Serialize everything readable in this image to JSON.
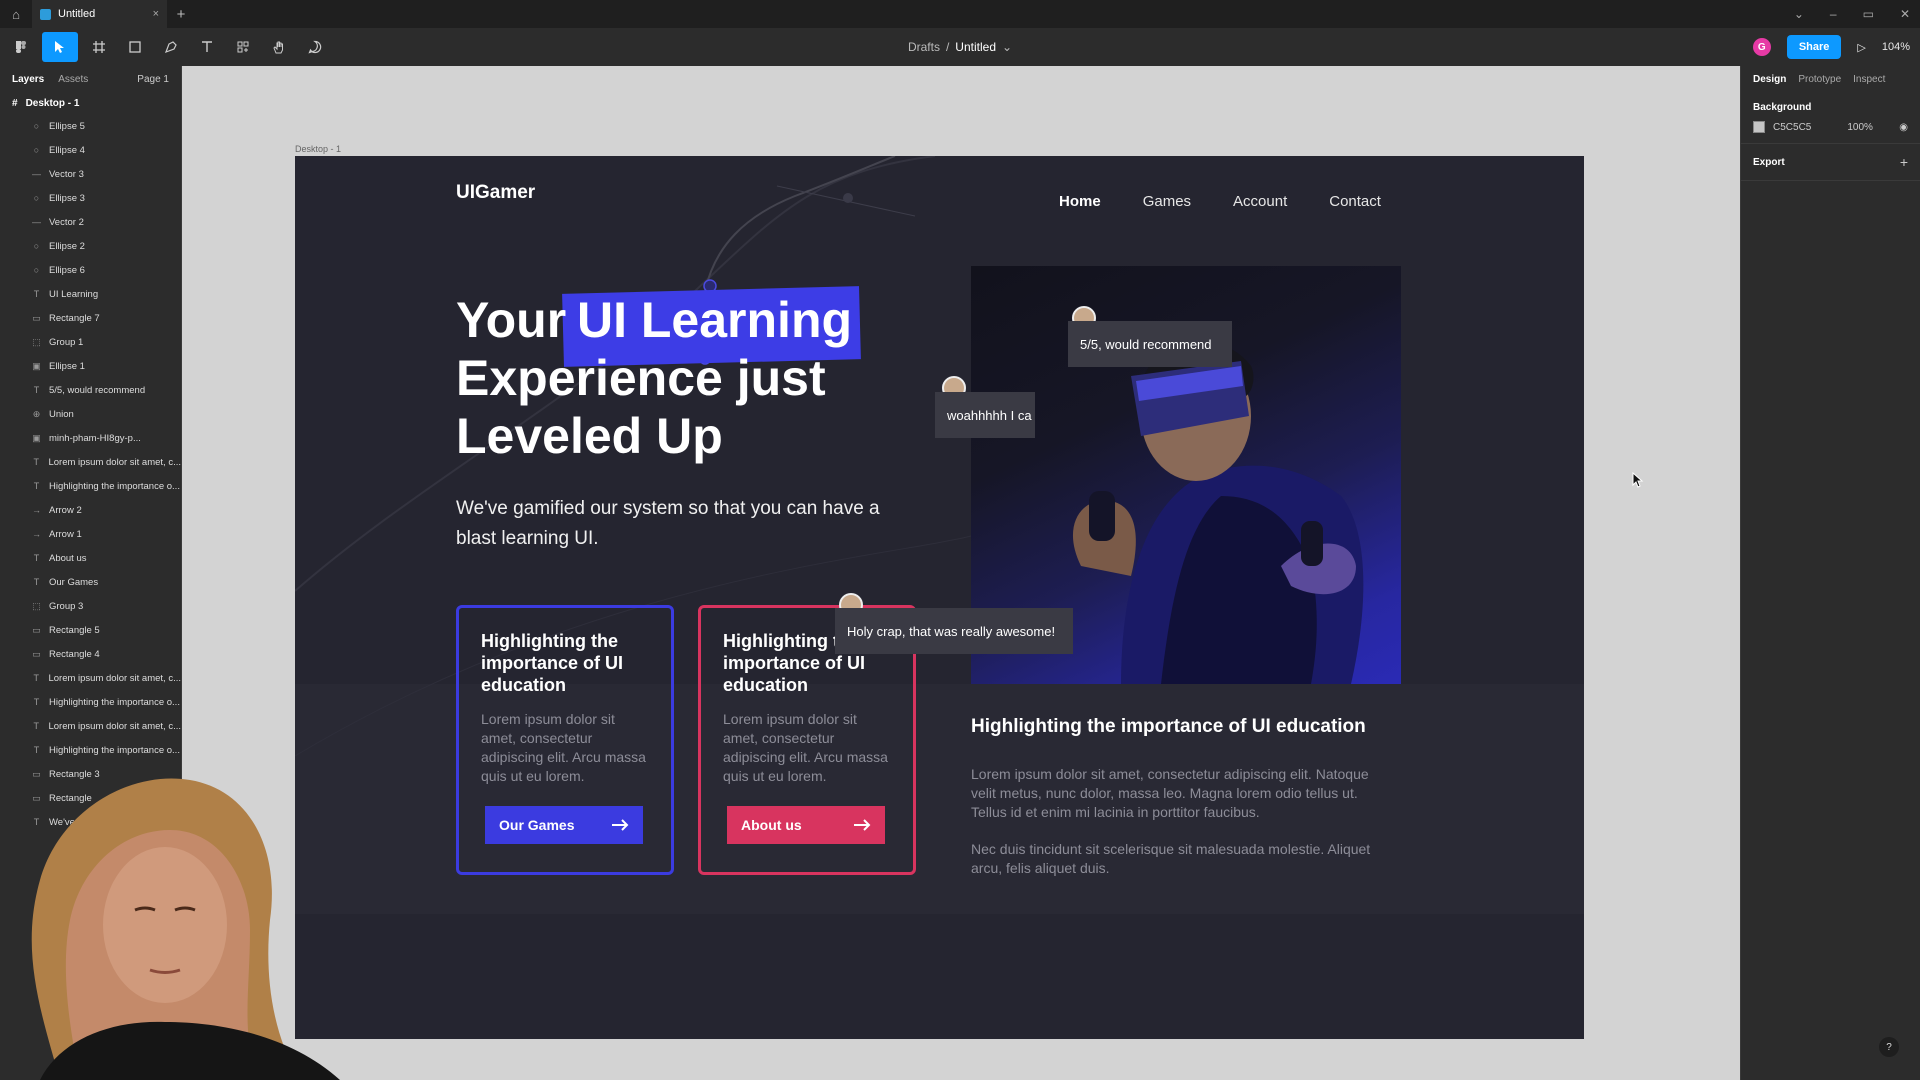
{
  "titlebar": {
    "tab_title": "Untitled",
    "tab_close": "×",
    "new_tab": "+",
    "controls": [
      "⌄",
      "–",
      "▭",
      "✕"
    ]
  },
  "toolbar": {
    "breadcrumb_team": "Drafts",
    "breadcrumb_sep": "/",
    "breadcrumb_file": "Untitled",
    "avatar_letter": "G",
    "share_label": "Share",
    "zoom": "104%"
  },
  "left_panel": {
    "tabs": [
      "Layers",
      "Assets"
    ],
    "page": "Page 1",
    "root": "Desktop - 1",
    "layers": [
      {
        "icon": "ellipse-icon",
        "name": "Ellipse 5"
      },
      {
        "icon": "ellipse-icon",
        "name": "Ellipse 4"
      },
      {
        "icon": "vector-icon",
        "name": "Vector 3"
      },
      {
        "icon": "ellipse-icon",
        "name": "Ellipse 3"
      },
      {
        "icon": "vector-icon",
        "name": "Vector 2"
      },
      {
        "icon": "ellipse-icon",
        "name": "Ellipse 2"
      },
      {
        "icon": "ellipse-icon",
        "name": "Ellipse 6"
      },
      {
        "icon": "text-icon",
        "name": "UI Learning"
      },
      {
        "icon": "rectangle-icon",
        "name": "Rectangle 7"
      },
      {
        "icon": "group-icon",
        "name": "Group 1"
      },
      {
        "icon": "image-icon",
        "name": "Ellipse 1"
      },
      {
        "icon": "text-icon",
        "name": "5/5, would recommend"
      },
      {
        "icon": "union-icon",
        "name": "Union"
      },
      {
        "icon": "image-icon",
        "name": "minh-pham-HI8gy-p..."
      },
      {
        "icon": "text-icon",
        "name": "Lorem ipsum dolor sit amet, c..."
      },
      {
        "icon": "text-icon",
        "name": "Highlighting the importance o..."
      },
      {
        "icon": "arrow-icon",
        "name": "Arrow 2"
      },
      {
        "icon": "arrow-icon",
        "name": "Arrow 1"
      },
      {
        "icon": "text-icon",
        "name": "About us"
      },
      {
        "icon": "text-icon",
        "name": "Our Games"
      },
      {
        "icon": "group-icon",
        "name": "Group 3"
      },
      {
        "icon": "rectangle-icon",
        "name": "Rectangle 5"
      },
      {
        "icon": "rectangle-icon",
        "name": "Rectangle 4"
      },
      {
        "icon": "text-icon",
        "name": "Lorem ipsum dolor sit amet, c..."
      },
      {
        "icon": "text-icon",
        "name": "Highlighting the importance o..."
      },
      {
        "icon": "text-icon",
        "name": "Lorem ipsum dolor sit amet, c..."
      },
      {
        "icon": "text-icon",
        "name": "Highlighting the importance o..."
      },
      {
        "icon": "rectangle-icon",
        "name": "Rectangle 3"
      },
      {
        "icon": "rectangle-icon",
        "name": "Rectangle"
      },
      {
        "icon": "text-icon",
        "name": "We've"
      }
    ]
  },
  "right_panel": {
    "tabs": [
      "Design",
      "Prototype",
      "Inspect"
    ],
    "background_title": "Background",
    "bg_hex": "C5C5C5",
    "bg_opacity": "100%",
    "export_title": "Export",
    "add": "+"
  },
  "canvas": {
    "frame_label": "Desktop - 1"
  },
  "site": {
    "logo": "UIGamer",
    "nav": [
      "Home",
      "Games",
      "Account",
      "Contact"
    ],
    "hero_word1": "Your",
    "hero_highlight": "UI Learning",
    "hero_line2": "Experience just",
    "hero_line3": "Leveled Up",
    "hero_sub": "We've gamified our system so that you can have a blast learning UI.",
    "cards": [
      {
        "title": "Highlighting the importance of UI education",
        "body": "Lorem ipsum dolor sit amet, consectetur adipiscing elit. Arcu massa quis ut eu lorem.",
        "button": "Our Games",
        "color": "#3b3be0"
      },
      {
        "title": "Highlighting the importance of UI education",
        "body": "Lorem ipsum dolor sit amet, consectetur adipiscing elit. Arcu massa quis ut eu lorem.",
        "button": "About us",
        "color": "#d8345f"
      }
    ],
    "reviews": [
      "5/5, would recommend",
      "woahhhhh I ca",
      "Holy crap, that was really awesome!"
    ],
    "section_title": "Highlighting the importance of UI education",
    "section_p1": "Lorem ipsum dolor sit amet, consectetur adipiscing elit. Natoque velit metus, nunc dolor, massa leo. Magna lorem odio tellus ut. Tellus id et enim mi lacinia in porttitor faucibus.",
    "section_p2": "Nec duis tincidunt sit scelerisque sit malesuada molestie. Aliquet arcu, felis aliquet duis."
  },
  "help": "?"
}
